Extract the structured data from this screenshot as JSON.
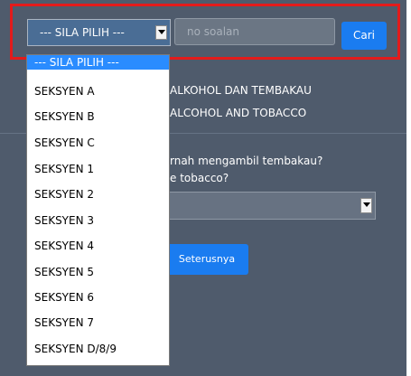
{
  "section_filter": {
    "selected_label": "--- SILA PILIH ---",
    "options": [
      "--- SILA PILIH ---",
      "SEKSYEN A",
      "SEKSYEN B",
      "SEKSYEN C",
      "SEKSYEN 1",
      "SEKSYEN 2",
      "SEKSYEN 3",
      "SEKSYEN 4",
      "SEKSYEN 5",
      "SEKSYEN 6",
      "SEKSYEN 7",
      "SEKSYEN D/8/9"
    ]
  },
  "search": {
    "placeholder": "no soalan",
    "button_label": "Cari"
  },
  "section_heading": {
    "line1": "ALKOHOL DAN TEMBAKAU",
    "line2": "ALCOHOL AND TOBACCO"
  },
  "question": {
    "line1": "rnah mengambil tembakau?",
    "line2": "e tobacco?"
  },
  "next_button_label": "Seterusnya",
  "colors": {
    "highlight": "#e31b1b",
    "accent": "#1a7cf0",
    "background": "#4f5b6c"
  },
  "icons": {
    "dropdown_arrow": "chevron-down-icon"
  }
}
